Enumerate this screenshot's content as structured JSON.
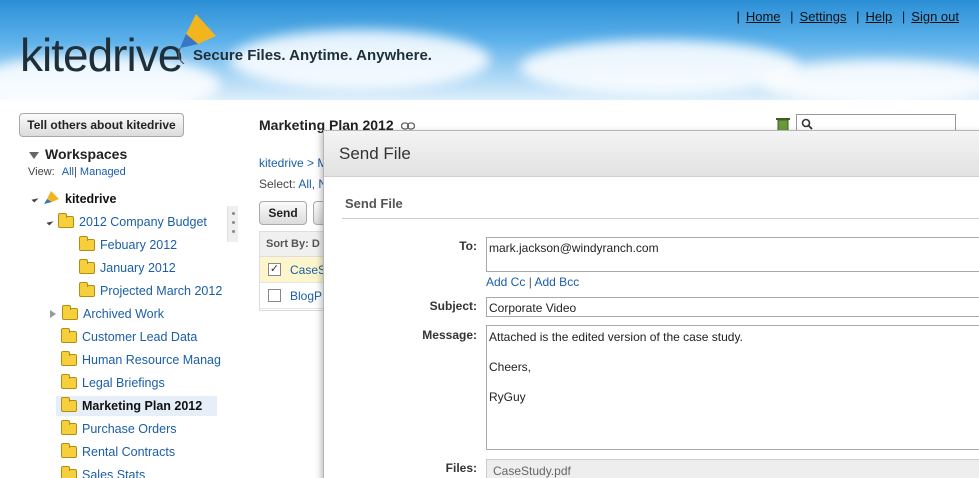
{
  "header": {
    "logo": "kitedrive",
    "tagline": "Secure Files. Anytime. Anywhere.",
    "links": [
      "Home",
      "Settings",
      "Help",
      "Sign out"
    ]
  },
  "sidebar": {
    "tell_button": "Tell others about kitedrive",
    "workspaces_title": "Workspaces",
    "view_label": "View:",
    "view_all": "All",
    "view_managed": "Managed",
    "root": "kitedrive",
    "items": [
      "2012 Company Budget",
      "Febuary 2012",
      "January 2012",
      "Projected March 2012",
      "Archived Work",
      "Customer Lead Data",
      "Human Resource Manag",
      "Legal Briefings",
      "Marketing Plan 2012",
      "Purchase Orders",
      "Rental Contracts",
      "Sales Stats"
    ]
  },
  "main": {
    "title": "Marketing Plan 2012",
    "breadcrumb": "kitedrive > M",
    "select_label": "Select:",
    "select_all": "All, N",
    "send_label": "Send",
    "sort_label": "Sort By: D",
    "files": [
      "CaseS",
      "BlogP"
    ]
  },
  "modal": {
    "title": "Send File",
    "subtitle": "Send File",
    "to_label": "To:",
    "to_value": "mark.jackson@windyranch.com",
    "add_cc": "Add Cc",
    "add_sep": "|",
    "add_bcc": "Add Bcc",
    "subject_label": "Subject:",
    "subject_value": "Corporate Video",
    "message_label": "Message:",
    "message_line1": "Attached is the edited version of the case study.",
    "message_line2": "Cheers,",
    "message_line3": "RyGuy",
    "files_label": "Files:",
    "files_value": "CaseStudy.pdf"
  },
  "colors": {
    "link": "#1a5ea8",
    "selected_bg": "#e6eef8",
    "checked_row": "#fdf6cc"
  }
}
